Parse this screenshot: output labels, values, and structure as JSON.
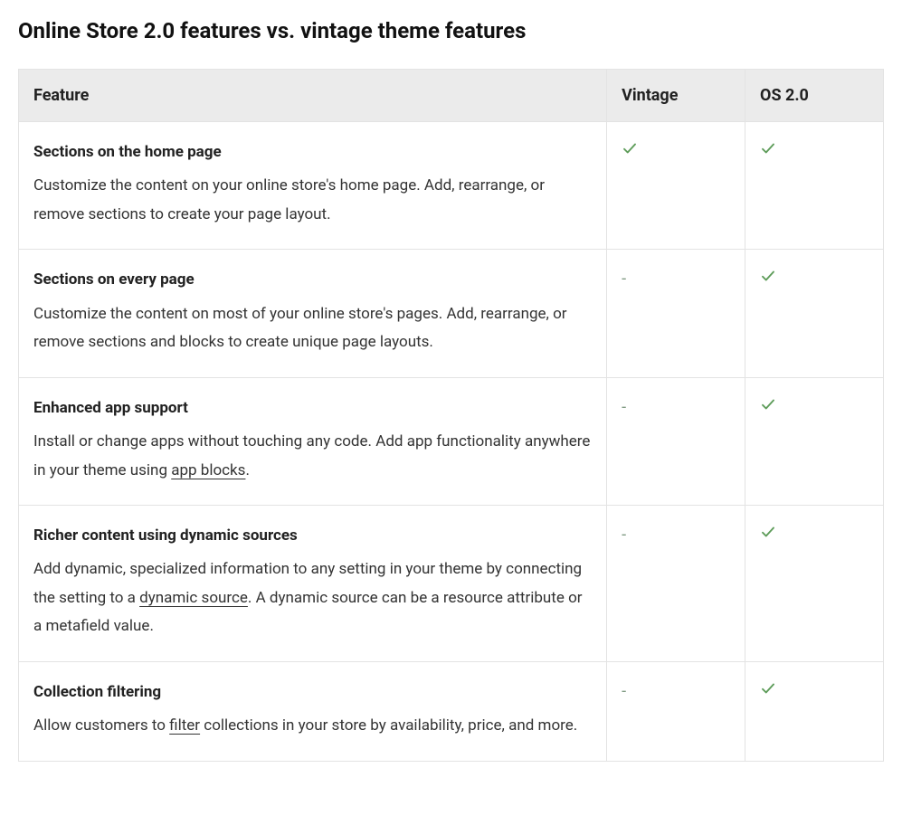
{
  "title": "Online Store 2.0 features vs. vintage theme features",
  "columns": {
    "feature": "Feature",
    "vintage": "Vintage",
    "os20": "OS 2.0"
  },
  "marks": {
    "check_color": "#5d9c59"
  },
  "rows": [
    {
      "title": "Sections on the home page",
      "desc_before": "Customize the content on your online store's home page. Add, rearrange, or remove sections to create your page layout.",
      "link_text": "",
      "desc_after": "",
      "vintage": "check",
      "os20": "check"
    },
    {
      "title": "Sections on every page",
      "desc_before": "Customize the content on most of your online store's pages. Add, rearrange, or remove sections and blocks to create unique page layouts.",
      "link_text": "",
      "desc_after": "",
      "vintage": "dash",
      "os20": "check"
    },
    {
      "title": "Enhanced app support",
      "desc_before": "Install or change apps without touching any code. Add app functionality anywhere in your theme using ",
      "link_text": "app blocks",
      "desc_after": ".",
      "vintage": "dash",
      "os20": "check"
    },
    {
      "title": "Richer content using dynamic sources",
      "desc_before": "Add dynamic, specialized information to any setting in your theme by connecting the setting to a ",
      "link_text": "dynamic source",
      "desc_after": ". A dynamic source can be a resource attribute or a metafield value.",
      "vintage": "dash",
      "os20": "check"
    },
    {
      "title": "Collection filtering",
      "desc_before": "Allow customers to ",
      "link_text": "filter",
      "desc_after": " collections in your store by availability, price, and more.",
      "vintage": "dash",
      "os20": "check"
    }
  ]
}
